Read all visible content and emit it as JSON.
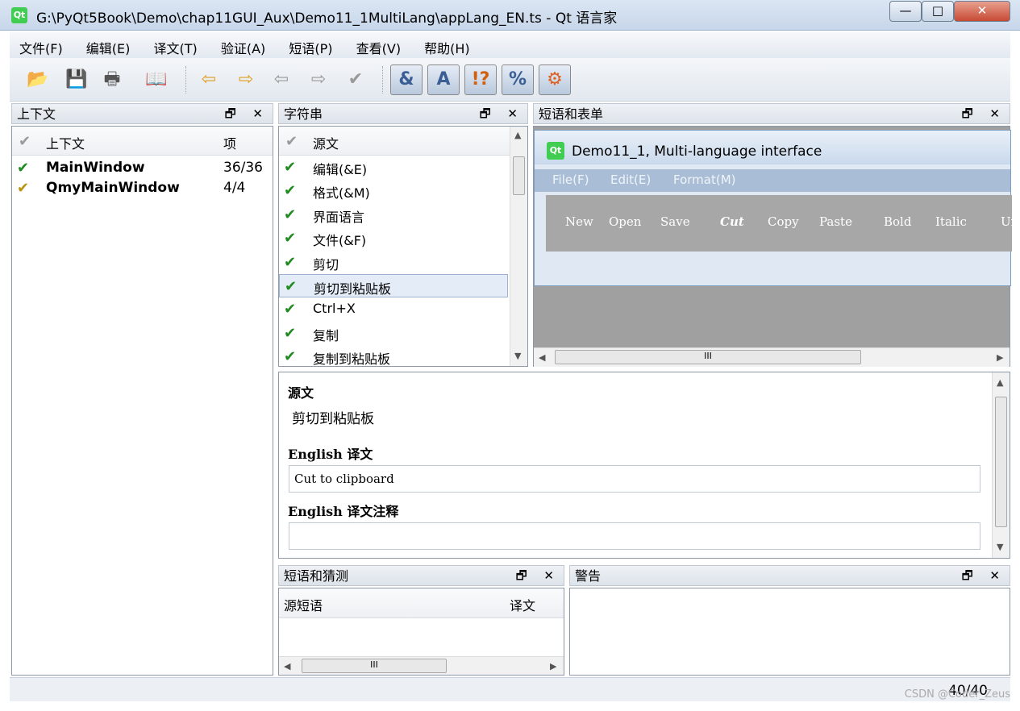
{
  "window": {
    "app_icon": "Qt",
    "title": "G:\\PyQt5Book\\Demo\\chap11GUI_Aux\\Demo11_1MultiLang\\appLang_EN.ts - Qt 语言家",
    "min": "—",
    "max": "□",
    "close": "✕"
  },
  "menubar": [
    "文件(F)",
    "编辑(E)",
    "译文(T)",
    "验证(A)",
    "短语(P)",
    "查看(V)",
    "帮助(H)"
  ],
  "toolbar": {
    "icons": [
      "open-icon",
      "save-icon",
      "print-icon",
      "phrasebook-icon",
      "prev-icon",
      "next-icon",
      "prev-unfinished-icon",
      "next-unfinished-icon",
      "done-next-icon",
      "accelerator-check-icon",
      "punctuation-check-icon",
      "phrase-match-check-icon",
      "placemarker-check-icon",
      "same-text-check-icon"
    ],
    "glyphs": [
      "📂",
      "💾",
      "🖶",
      "📖",
      "⇦",
      "⇨",
      "⇦",
      "⇨",
      "✔",
      "&",
      "A",
      "!?",
      "%",
      "⚙"
    ]
  },
  "dock_controls": "🗗 ✕",
  "context": {
    "title": "上下文",
    "col_check": "✔",
    "col_context": "上下文",
    "col_items": "项",
    "rows": [
      {
        "check": "✔",
        "name": "MainWindow",
        "items": "36/36"
      },
      {
        "check": "✔",
        "name": "QmyMainWindow",
        "items": "4/4"
      }
    ]
  },
  "strings": {
    "title": "字符串",
    "col_check": "✔",
    "col_source": "源文",
    "rows": [
      "编辑(&E)",
      "格式(&M)",
      "界面语言",
      "文件(&F)",
      "剪切",
      "剪切到粘贴板",
      "Ctrl+X",
      "复制",
      "复制到粘贴板"
    ],
    "selected_index": 5,
    "up": "▲",
    "down": "▼"
  },
  "forms": {
    "title": "短语和表单",
    "preview_title": "Demo11_1, Multi-language interface",
    "preview_menu": [
      "File(F)",
      "Edit(E)",
      "Format(M)"
    ],
    "preview_toolbar": [
      "New",
      "Open",
      "Save",
      "Cut",
      "Copy",
      "Paste",
      "Bold",
      "Italic",
      "Un"
    ],
    "scroll_left": "◀",
    "scroll_right": "▶",
    "scroll_grip": "III"
  },
  "editor": {
    "source_label": "源文",
    "source_text": "剪切到粘贴板",
    "translation_label": "English 译文",
    "translation_value": "Cut to clipboard",
    "comment_label": "English 译文注释",
    "comment_value": ""
  },
  "phrases": {
    "title": "短语和猜测",
    "col_source": "源短语",
    "col_translation": "译文"
  },
  "warnings": {
    "title": "警告"
  },
  "status": {
    "count": "40/40",
    "watermark": "CSDN @Coder_Zeus"
  }
}
